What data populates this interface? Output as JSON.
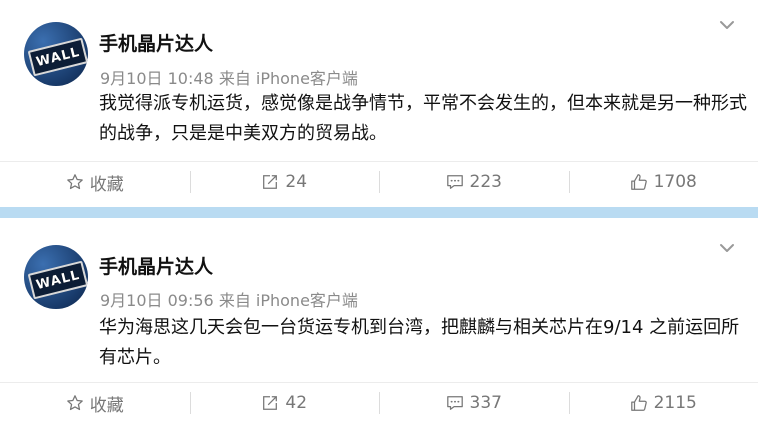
{
  "posts": [
    {
      "username": "手机晶片达人",
      "meta": "9月10日 10:48 来自 iPhone客户端",
      "text": "我觉得派专机运货，感觉像是战争情节，平常不会发生的，但本来就是另一种形式的战争，只是是中美双方的贸易战。",
      "avatar_sign": "WALL",
      "actions": {
        "favorite": "收藏",
        "repost": "24",
        "comment": "223",
        "like": "1708"
      }
    },
    {
      "username": "手机晶片达人",
      "meta": "9月10日 09:56 来自 iPhone客户端",
      "text": "华为海思这几天会包一台货运专机到台湾，把麒麟与相关芯片在9/14 之前运回所有芯片。",
      "avatar_sign": "WALL",
      "actions": {
        "favorite": "收藏",
        "repost": "42",
        "comment": "337",
        "like": "2115"
      }
    }
  ],
  "colors": {
    "separator": "#b9dbf2",
    "meta_text": "#8a8a8a",
    "action_text": "#777777"
  },
  "icons": [
    "chevron-down-icon",
    "star-icon",
    "repost-icon",
    "comment-icon",
    "like-icon"
  ]
}
